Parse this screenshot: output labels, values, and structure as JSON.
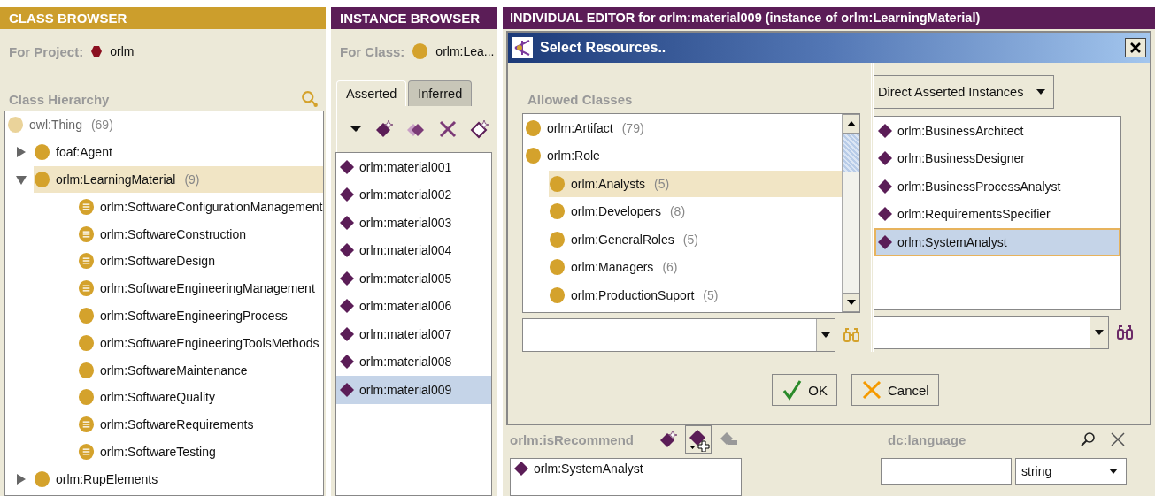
{
  "class_browser": {
    "title": "CLASS BROWSER",
    "project_label": "For Project:",
    "project": "orlm",
    "hierarchy_label": "Class Hierarchy",
    "tree": [
      {
        "label": "owl:Thing",
        "count": "(69)",
        "kind": "thing",
        "selected": false,
        "children": [
          {
            "label": "foaf:Agent",
            "kind": "class",
            "expanded": false,
            "selected": false
          },
          {
            "label": "orlm:LearningMaterial",
            "count": "(9)",
            "kind": "class",
            "expanded": true,
            "selected": true,
            "children": [
              {
                "label": "orlm:SoftwareConfigurationManagement",
                "kind": "defined",
                "selected": false
              },
              {
                "label": "orlm:SoftwareConstruction",
                "kind": "defined",
                "selected": false
              },
              {
                "label": "orlm:SoftwareDesign",
                "kind": "defined",
                "selected": false
              },
              {
                "label": "orlm:SoftwareEngineeringManagement",
                "kind": "defined",
                "selected": false
              },
              {
                "label": "orlm:SoftwareEngineeringProcess",
                "kind": "class",
                "selected": false
              },
              {
                "label": "orlm:SoftwareEngineeringToolsMethods",
                "kind": "class",
                "selected": false
              },
              {
                "label": "orlm:SoftwareMaintenance",
                "kind": "class",
                "selected": false
              },
              {
                "label": "orlm:SoftwareQuality",
                "kind": "class",
                "selected": false
              },
              {
                "label": "orlm:SoftwareRequirements",
                "kind": "defined",
                "selected": false
              },
              {
                "label": "orlm:SoftwareTesting",
                "kind": "defined",
                "selected": false
              }
            ]
          },
          {
            "label": "orlm:RupElements",
            "kind": "class",
            "expanded": false,
            "selected": false
          }
        ]
      }
    ]
  },
  "instance_browser": {
    "title": "INSTANCE BROWSER",
    "class_label": "For Class:",
    "class": "orlm:Lea...",
    "tabs": [
      {
        "label": "Asserted",
        "selected": true
      },
      {
        "label": "Inferred",
        "selected": false
      }
    ],
    "instances": [
      {
        "label": "orlm:material001",
        "selected": false
      },
      {
        "label": "orlm:material002",
        "selected": false
      },
      {
        "label": "orlm:material003",
        "selected": false
      },
      {
        "label": "orlm:material004",
        "selected": false
      },
      {
        "label": "orlm:material005",
        "selected": false
      },
      {
        "label": "orlm:material006",
        "selected": false
      },
      {
        "label": "orlm:material007",
        "selected": false
      },
      {
        "label": "orlm:material008",
        "selected": false
      },
      {
        "label": "orlm:material009",
        "selected": true
      }
    ]
  },
  "individual_editor": {
    "title": "INDIVIDUAL EDITOR for orlm:material009   (instance of orlm:LearningMaterial)",
    "property_label": "orlm:isRecommend",
    "property_values": [
      "orlm:SystemAnalyst"
    ],
    "language_label": "dc:language",
    "language_type": "string"
  },
  "dialog": {
    "title": "Select Resources..",
    "allowed_label": "Allowed Classes",
    "mode": "Direct Asserted Instances",
    "classes": [
      {
        "label": "orlm:Artifact",
        "count": "(79)",
        "selected": false
      },
      {
        "label": "orlm:Role",
        "selected": false,
        "children": [
          {
            "label": "orlm:Analysts",
            "count": "(5)",
            "selected": true
          },
          {
            "label": "orlm:Developers",
            "count": "(8)",
            "selected": false
          },
          {
            "label": "orlm:GeneralRoles",
            "count": "(5)",
            "selected": false
          },
          {
            "label": "orlm:Managers",
            "count": "(6)",
            "selected": false
          },
          {
            "label": "orlm:ProductionSuport",
            "count": "(5)",
            "selected": false
          }
        ]
      }
    ],
    "instances": [
      {
        "label": "orlm:BusinessArchitect",
        "selected": false
      },
      {
        "label": "orlm:BusinessDesigner",
        "selected": false
      },
      {
        "label": "orlm:BusinessProcessAnalyst",
        "selected": false
      },
      {
        "label": "orlm:RequirementsSpecifier",
        "selected": false
      },
      {
        "label": "orlm:SystemAnalyst",
        "selected": true
      }
    ],
    "buttons": [
      {
        "label": "OK",
        "kind": "ok"
      },
      {
        "label": "Cancel",
        "kind": "cancel"
      }
    ]
  }
}
